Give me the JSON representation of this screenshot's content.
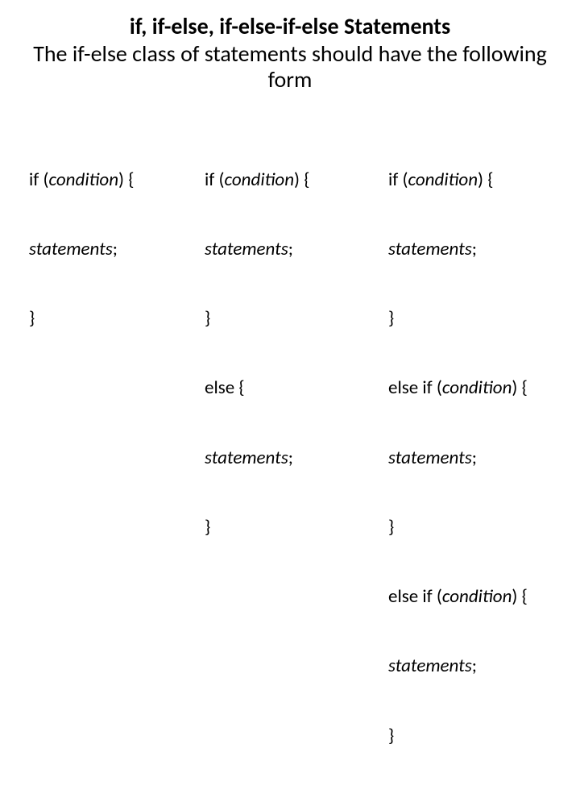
{
  "header": {
    "title": "if, if-else, if-else-if-else Statements",
    "subtitle": "The if-else class of statements should have the following form"
  },
  "col1": {
    "l1a": "if (",
    "l1b": "condition",
    "l1c": ") {",
    "l2a": "statements",
    "l2b": ";",
    "l3": "}"
  },
  "col2": {
    "l1a": "if (",
    "l1b": "condition",
    "l1c": ") {",
    "l2a": "statements",
    "l2b": ";",
    "l3": "}",
    "l4": "else {",
    "l5a": "statements",
    "l5b": ";",
    "l6": "}"
  },
  "col3": {
    "l1a": "if (",
    "l1b": "condition",
    "l1c": ") {",
    "l2a": "statements",
    "l2b": ";",
    "l3": "}",
    "l4a": "else if (",
    "l4b": "condition",
    "l4c": ") {",
    "l5a": "statements",
    "l5b": ";",
    "l6": "}",
    "l7a": "else if (",
    "l7b": "condition",
    "l7c": ") {",
    "l8a": "statements",
    "l8b": ";",
    "l9": "}"
  }
}
